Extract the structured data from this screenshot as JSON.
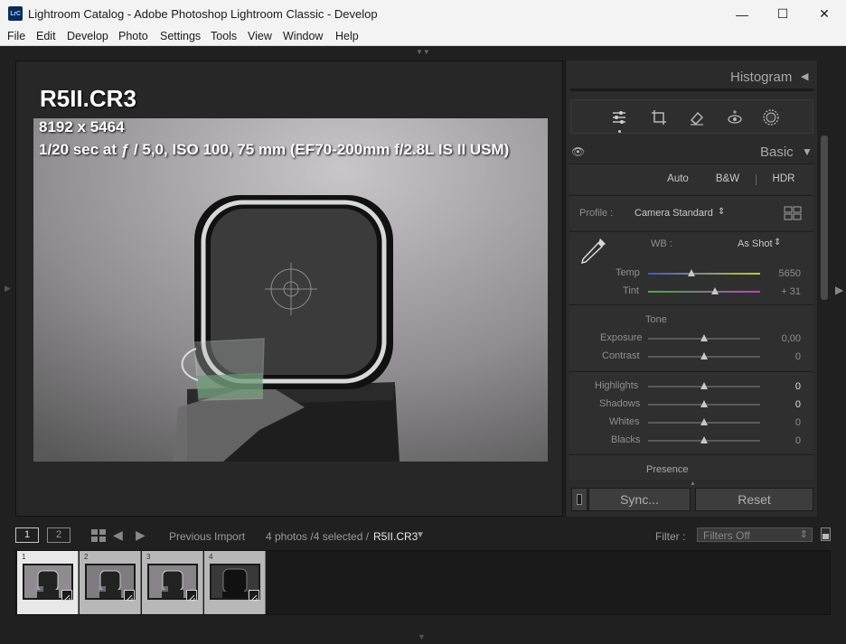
{
  "window": {
    "title": "Lightroom Catalog - Adobe Photoshop Lightroom Classic - Develop",
    "app_icon": "LrC",
    "minimize": "—",
    "maximize": "☐",
    "close": "✕"
  },
  "menu": [
    "File",
    "Edit",
    "Develop",
    "Photo",
    "Settings",
    "Tools",
    "View",
    "Window",
    "Help"
  ],
  "photo_info": {
    "filename": "R5II.CR3",
    "dimensions": "8192 x 5464",
    "exposure": "1/20 sec at ƒ / 5,0, ISO 100, 75 mm (EF70-200mm f/2.8L IS II USM)"
  },
  "right_panel": {
    "histogram_label": "Histogram",
    "basic_label": "Basic",
    "treatment_buttons": [
      "Auto",
      "B&W",
      "HDR"
    ],
    "profile_label": "Profile :",
    "profile_value": "Camera Standard",
    "wb_label": "WB :",
    "wb_value": "As Shot",
    "temp": {
      "label": "Temp",
      "value": "5650",
      "pos": 0.39
    },
    "tint": {
      "label": "Tint",
      "value": "+ 31",
      "pos": 0.6
    },
    "tone_label": "Tone",
    "exposure": {
      "label": "Exposure",
      "value": "0,00",
      "pos": 0.5
    },
    "contrast": {
      "label": "Contrast",
      "value": "0",
      "pos": 0.5
    },
    "highlights": {
      "label": "Highlights",
      "value": "0",
      "pos": 0.5
    },
    "shadows": {
      "label": "Shadows",
      "value": "0",
      "pos": 0.5
    },
    "whites": {
      "label": "Whites",
      "value": "0",
      "pos": 0.5
    },
    "blacks": {
      "label": "Blacks",
      "value": "0",
      "pos": 0.5
    },
    "presence_label": "Presence",
    "sync_label": "Sync...",
    "reset_label": "Reset"
  },
  "filmstrip_bar": {
    "view1": "1",
    "view2": "2",
    "source": "Previous Import",
    "count": "4 photos /4 selected /",
    "current": "R5II.CR3",
    "filter_label": "Filter :",
    "filter_value": "Filters Off"
  },
  "thumbnails": [
    {
      "num": "1"
    },
    {
      "num": "2"
    },
    {
      "num": "3"
    },
    {
      "num": "4"
    }
  ]
}
